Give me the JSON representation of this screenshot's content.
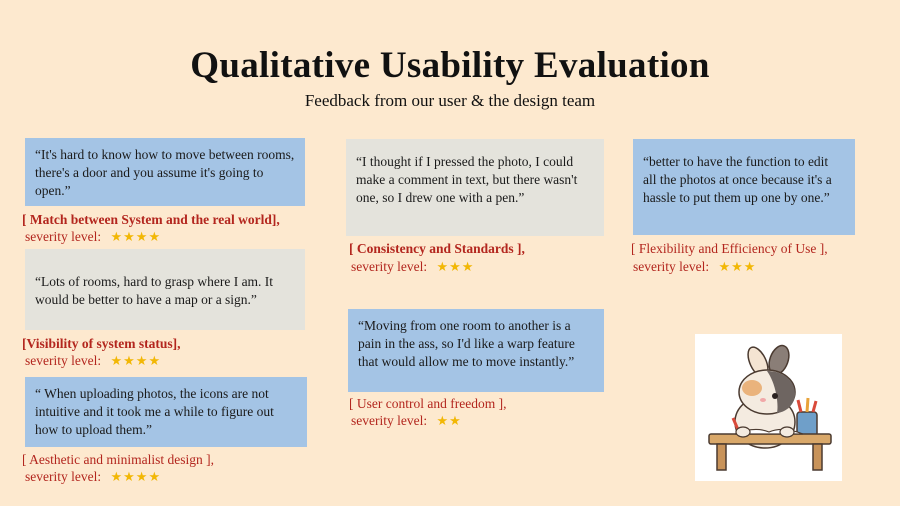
{
  "header": {
    "title": "Qualitative Usability Evaluation",
    "subtitle": "Feedback from our user & the design team"
  },
  "items": [
    {
      "quote": "“It's hard to know how to move between rooms, there's a door and you assume it's going to open.”",
      "heuristic": "[ Match between System and the real world],",
      "severity_label": "severity level:",
      "severity": 4
    },
    {
      "quote": "“Lots of rooms, hard to grasp where I am. It would be better to have a map or a sign.”",
      "heuristic": "[Visibility of system status],",
      "severity_label": "severity level:",
      "severity": 4
    },
    {
      "quote": "“ When uploading photos, the icons are  not intuitive and it took me a while to figure out how to upload them.”",
      "heuristic": "[ Aesthetic and minimalist design ],",
      "severity_label": "severity level:",
      "severity": 4
    },
    {
      "quote": "“I thought if I pressed the photo, I could make a comment in text, but there wasn't one, so I drew one with a pen.”",
      "heuristic": "[ Consistency and Standards ],",
      "severity_label": "severity level:",
      "severity": 3
    },
    {
      "quote": "“Moving from one room to another is a pain in the ass, so I'd like a warp feature that would allow me to move instantly.”",
      "heuristic": "[ User control and freedom ],",
      "severity_label": "severity level:",
      "severity": 2
    },
    {
      "quote": "“better to have the function to edit all the photos at once because it's a hassle to put them up one by one.”",
      "heuristic": "[ Flexibility and Efficiency of Use ],",
      "severity_label": "severity level:",
      "severity": 3
    }
  ],
  "illustration": "cartoon-bunny-drawing-at-desk",
  "colors": {
    "background": "#fde9cf",
    "card_blue": "#a4c4e5",
    "card_gray": "#e4e3dc",
    "heuristic_red": "#b3261e",
    "star_gold": "#f2b705"
  }
}
